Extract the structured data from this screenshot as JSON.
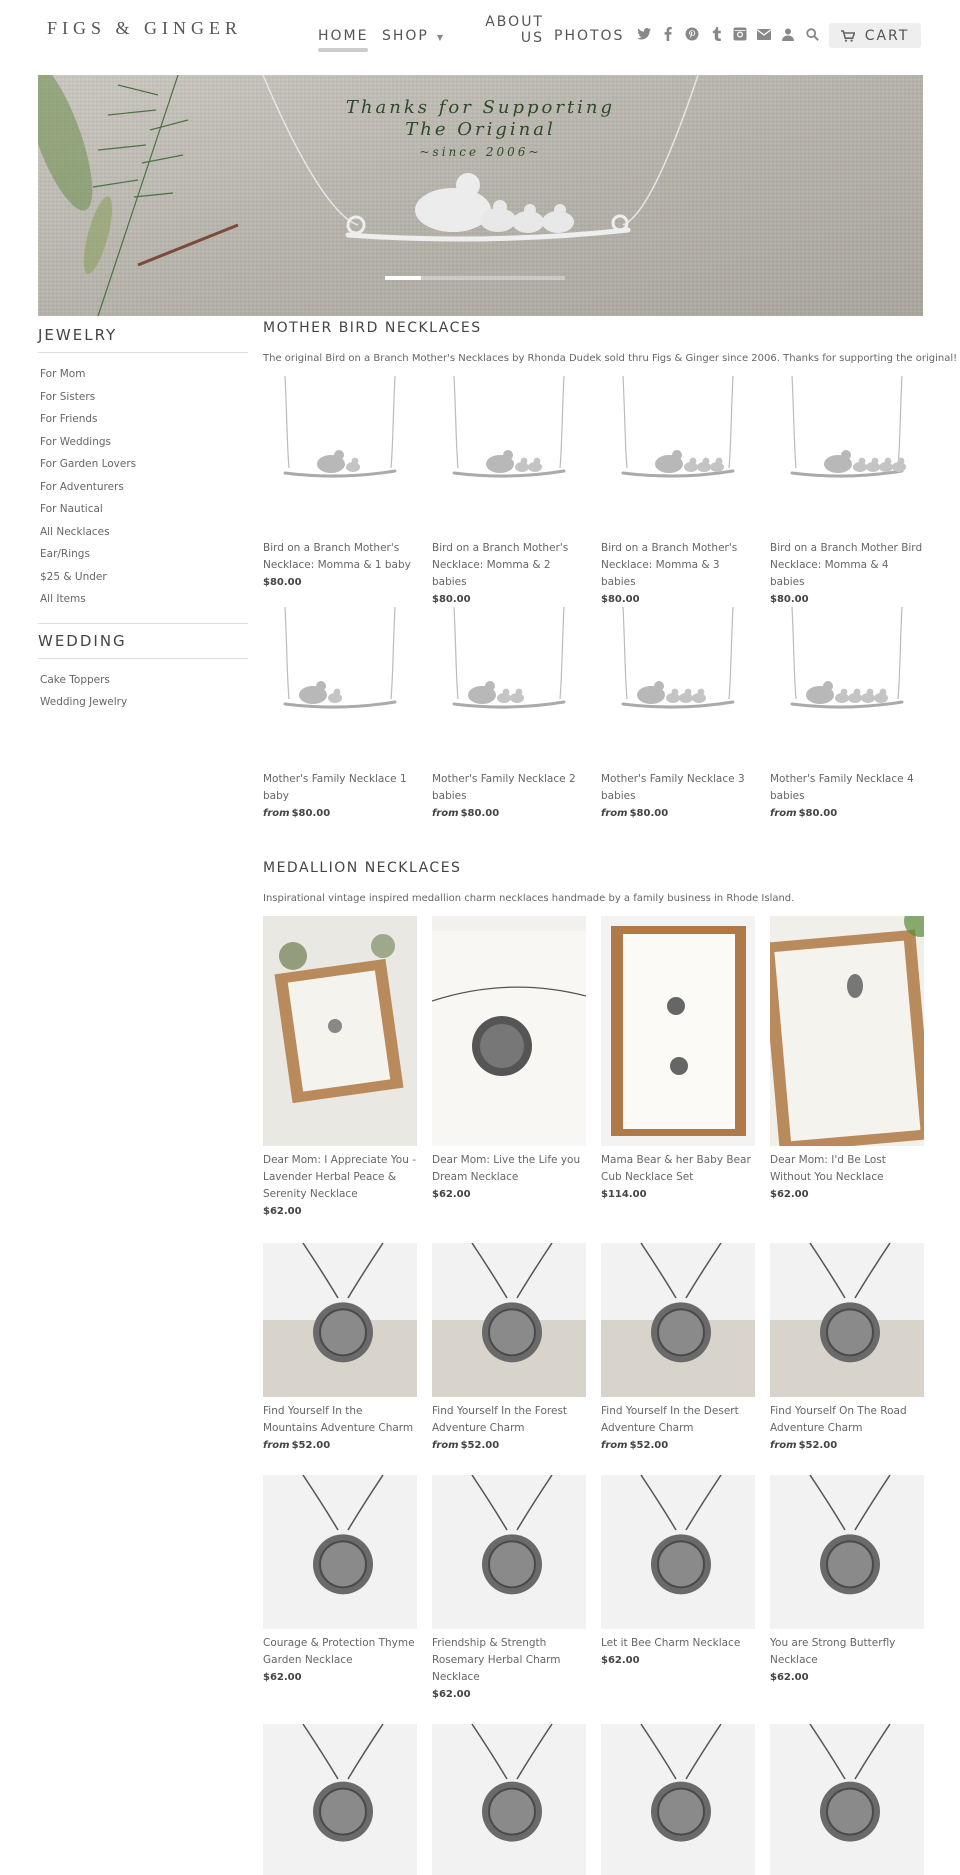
{
  "header": {
    "logo": "FIGS & GINGER",
    "nav": {
      "home": "HOME",
      "shop": "SHOP",
      "about_line1": "ABOUT",
      "about_line2": "US",
      "photos": "PHOTOS"
    },
    "icons": [
      "twitter-icon",
      "facebook-icon",
      "pinterest-icon",
      "tumblr-icon",
      "instagram-icon",
      "email-icon",
      "account-icon",
      "search-icon"
    ],
    "cart_label": "CART"
  },
  "banner": {
    "line1": "Thanks for Supporting",
    "line2": "The Original",
    "line3": "~since 2006~"
  },
  "sidebar": {
    "jewelry_title": "JEWELRY",
    "jewelry_items": [
      "For Mom",
      "For Sisters",
      "For Friends",
      "For Weddings",
      "For Garden Lovers",
      "For Adventurers",
      "For Nautical",
      "All Necklaces",
      "Ear/Rings",
      "$25 & Under",
      "All Items"
    ],
    "wedding_title": "WEDDING",
    "wedding_items": [
      "Cake Toppers",
      "Wedding Jewelry"
    ]
  },
  "mother_bird": {
    "title": "MOTHER BIRD NECKLACES",
    "description": "The original Bird on a Branch Mother's Necklaces by Rhonda Dudek sold thru Figs & Ginger since 2006. Thanks for supporting the original!",
    "products": [
      {
        "name": "Bird on a Branch Mother's Necklace: Momma & 1 baby",
        "from": "",
        "price": "$80.00"
      },
      {
        "name": "Bird on a Branch Mother's Necklace: Momma & 2 babies",
        "from": "",
        "price": "$80.00"
      },
      {
        "name": "Bird on a Branch Mother's Necklace: Momma & 3 babies",
        "from": "",
        "price": "$80.00"
      },
      {
        "name": "Bird on a Branch Mother Bird Necklace: Momma & 4 babies",
        "from": "",
        "price": "$80.00"
      },
      {
        "name": "Mother's Family Necklace 1 baby",
        "from": "from",
        "price": "$80.00"
      },
      {
        "name": "Mother's Family Necklace 2 babies",
        "from": "from",
        "price": "$80.00"
      },
      {
        "name": "Mother's Family Necklace 3 babies",
        "from": "from",
        "price": "$80.00"
      },
      {
        "name": "Mother's Family Necklace 4 babies",
        "from": "from",
        "price": "$80.00"
      }
    ]
  },
  "medallion": {
    "title": "MEDALLION NECKLACES",
    "description": "Inspirational vintage inspired medallion charm necklaces handmade by a family business in Rhode Island.",
    "products": [
      {
        "name": "Dear Mom: I Appreciate You - Lavender Herbal Peace & Serenity Necklace",
        "from": "",
        "price": "$62.00"
      },
      {
        "name": "Dear Mom: Live the Life you Dream Necklace",
        "from": "",
        "price": "$62.00"
      },
      {
        "name": "Mama Bear & her Baby Bear Cub Necklace Set",
        "from": "",
        "price": "$114.00"
      },
      {
        "name": "Dear Mom: I'd Be Lost Without You Necklace",
        "from": "",
        "price": "$62.00"
      },
      {
        "name": "Find Yourself In the Mountains Adventure Charm",
        "from": "from",
        "price": "$52.00"
      },
      {
        "name": "Find Yourself In the Forest Adventure Charm",
        "from": "from",
        "price": "$52.00"
      },
      {
        "name": "Find Yourself In the Desert Adventure Charm",
        "from": "from",
        "price": "$52.00"
      },
      {
        "name": "Find Yourself On The Road Adventure Charm",
        "from": "from",
        "price": "$52.00"
      },
      {
        "name": "Courage & Protection Thyme Garden Necklace",
        "from": "",
        "price": "$62.00"
      },
      {
        "name": "Friendship & Strength Rosemary Herbal Charm Necklace",
        "from": "",
        "price": "$62.00"
      },
      {
        "name": "Let it Bee Charm Necklace",
        "from": "",
        "price": "$62.00"
      },
      {
        "name": "You are Strong Butterfly Necklace",
        "from": "",
        "price": "$62.00"
      }
    ]
  }
}
